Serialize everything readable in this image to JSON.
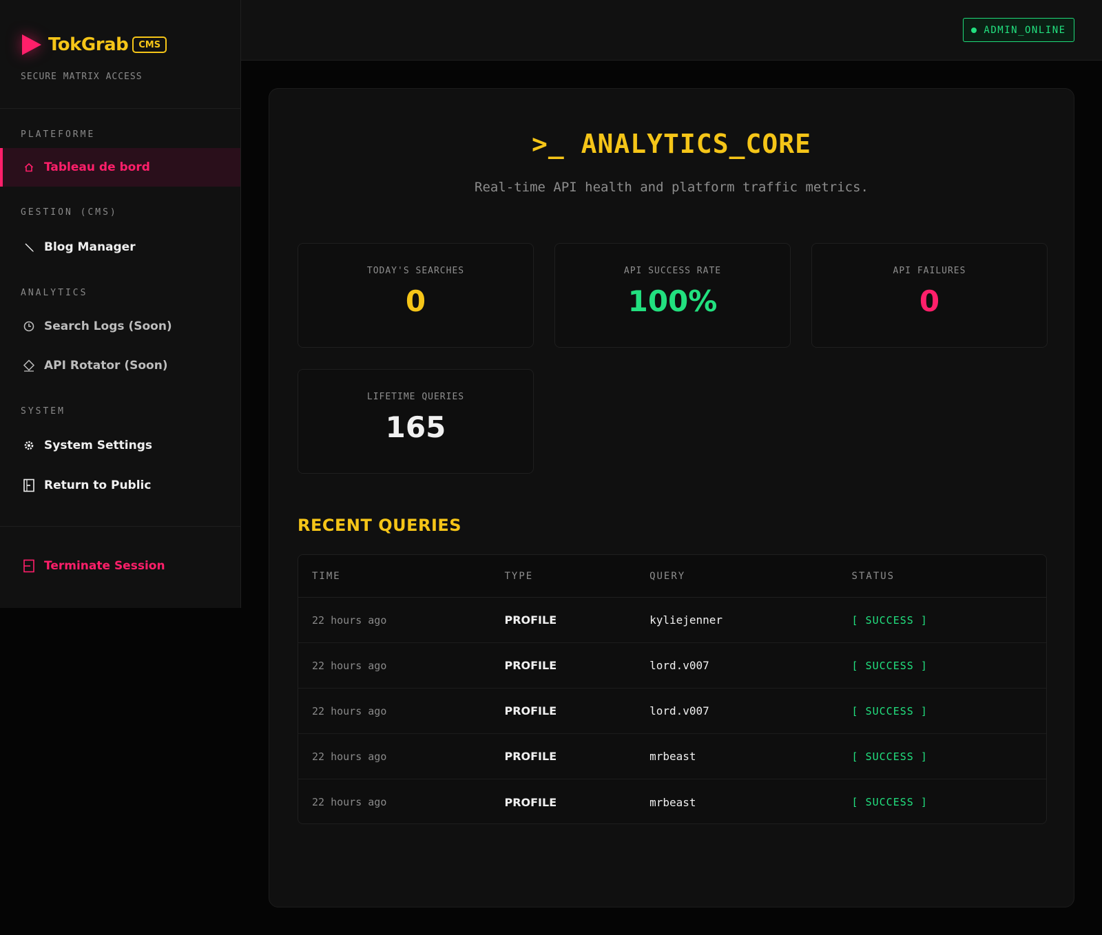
{
  "brand": {
    "name": "TokGrab",
    "badge": "CMS",
    "subtitle": "SECURE MATRIX ACCESS"
  },
  "sidebar": {
    "sections": {
      "platform": "PLATEFORME",
      "cms": "GESTION (CMS)",
      "analytics": "ANALYTICS",
      "system": "SYSTEM"
    },
    "items": {
      "dashboard": {
        "label": "Tableau de bord",
        "icon": "home-icon"
      },
      "blog": {
        "label": "Blog Manager",
        "icon": "pencil-icon"
      },
      "search_logs": {
        "label": "Search Logs (Soon)",
        "icon": "clock-icon"
      },
      "api_rotator": {
        "label": "API Rotator (Soon)",
        "icon": "diamond-icon"
      },
      "settings": {
        "label": "System Settings",
        "icon": "gear-icon"
      },
      "return": {
        "label": "Return to Public",
        "icon": "door-icon"
      },
      "logout": {
        "label": "Terminate Session",
        "icon": "logout-icon"
      }
    }
  },
  "topbar": {
    "status": "ADMIN_ONLINE"
  },
  "main": {
    "title": ">_ ANALYTICS_CORE",
    "subtitle": "Real-time API health and platform traffic metrics.",
    "stats": [
      {
        "label": "TODAY'S SEARCHES",
        "value": "0",
        "color": "#f5c518"
      },
      {
        "label": "API SUCCESS RATE",
        "value": "100%",
        "color": "#22e07f"
      },
      {
        "label": "API FAILURES",
        "value": "0",
        "color": "#ff1f6a"
      },
      {
        "label": "LIFETIME QUERIES",
        "value": "165",
        "color": "#f0f0f0"
      }
    ],
    "recent_title": "RECENT QUERIES",
    "table": {
      "headers": [
        "TIME",
        "TYPE",
        "QUERY",
        "STATUS"
      ],
      "rows": [
        [
          "22 hours ago",
          "PROFILE",
          "kyliejenner",
          "[ SUCCESS ]"
        ],
        [
          "22 hours ago",
          "PROFILE",
          "lord.v007",
          "[ SUCCESS ]"
        ],
        [
          "22 hours ago",
          "PROFILE",
          "lord.v007",
          "[ SUCCESS ]"
        ],
        [
          "22 hours ago",
          "PROFILE",
          "mrbeast",
          "[ SUCCESS ]"
        ],
        [
          "22 hours ago",
          "PROFILE",
          "mrbeast",
          "[ SUCCESS ]"
        ]
      ]
    }
  },
  "colors": {
    "accent_yellow": "#f5c518",
    "accent_pink": "#ff1f6a",
    "accent_green": "#22e07f"
  }
}
